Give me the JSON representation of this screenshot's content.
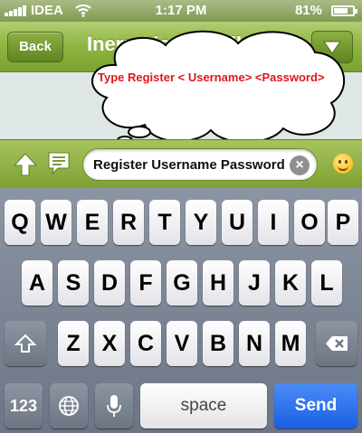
{
  "status_bar": {
    "carrier": "IDEA",
    "time": "1:17 PM",
    "battery_percent": "81%",
    "battery_level": 0.81
  },
  "nav": {
    "back_label": "Back",
    "title": "Inernational Calls",
    "dropdown_icon": "chevron-down-icon"
  },
  "hint": {
    "text": "Type Register < Username> <Password>",
    "color": "#e0161c"
  },
  "input": {
    "value": "Register Username Password",
    "clear_icon": "clear-icon",
    "left_icons": [
      "up-arrow-icon",
      "chat-bubble-icon"
    ],
    "right_icon": "emoji-icon"
  },
  "keyboard": {
    "row1": [
      "Q",
      "W",
      "E",
      "R",
      "T",
      "Y",
      "U",
      "I",
      "O",
      "P"
    ],
    "row2": [
      "A",
      "S",
      "D",
      "F",
      "G",
      "H",
      "J",
      "K",
      "L"
    ],
    "row3": [
      "Z",
      "X",
      "C",
      "V",
      "B",
      "N",
      "M"
    ],
    "numbers_label": "123",
    "space_label": "space",
    "send_label": "Send",
    "shift_icon": "shift-icon",
    "delete_icon": "delete-icon",
    "globe_icon": "globe-icon",
    "mic_icon": "microphone-icon",
    "send_color": "#1a5fe6"
  },
  "colors": {
    "nav_green": "#8fb540",
    "keyboard_bg": "#7c8594"
  }
}
